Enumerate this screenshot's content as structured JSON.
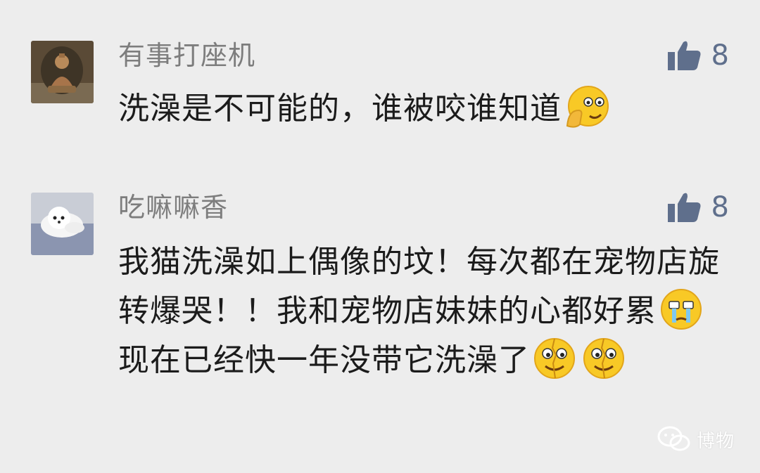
{
  "comments": [
    {
      "username": "有事打座机",
      "text_parts": [
        "洗澡是不可能的，谁被咬谁知道"
      ],
      "likes": "8",
      "avatar_icon": "buddha-statue-avatar",
      "emojis": [
        "facepalm-emoji"
      ]
    },
    {
      "username": "吃嘛嘛香",
      "text_parts": [
        "我猫洗澡如上偶像的坟！每次都在宠物店旋转爆哭！！我和宠物店妹妹的心都好累",
        " 现在已经快一年没带它洗澡了"
      ],
      "likes": "8",
      "avatar_icon": "white-puppy-avatar",
      "emojis": [
        "crying-emoji",
        "broken-smile-emoji",
        "broken-smile-emoji"
      ]
    }
  ],
  "watermark": {
    "text": "博物",
    "icon": "wechat-icon"
  },
  "colors": {
    "background": "#ededed",
    "username": "#7d7d7d",
    "text": "#1b1b1b",
    "like": "#5f6f8c"
  }
}
